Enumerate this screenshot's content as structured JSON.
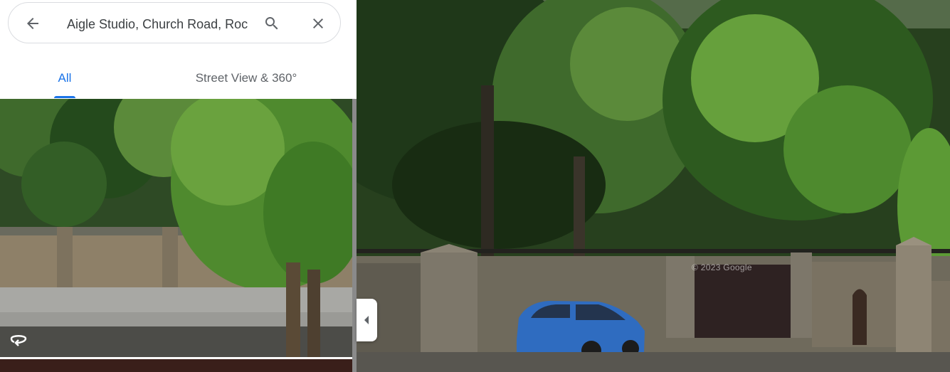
{
  "search": {
    "query": "Aigle Studio, Church Road, Roc",
    "back_icon": "arrow-back-icon",
    "search_icon": "search-icon",
    "clear_icon": "close-icon"
  },
  "tabs": [
    {
      "label": "All",
      "selected": true
    },
    {
      "label": "Street View & 360°",
      "selected": false
    }
  ],
  "thumbnail": {
    "icon": "360-panorama-icon"
  },
  "viewer": {
    "watermark": "© 2023 Google"
  },
  "colors": {
    "accent": "#1a73e8",
    "tab_inactive": "#5f6368"
  }
}
